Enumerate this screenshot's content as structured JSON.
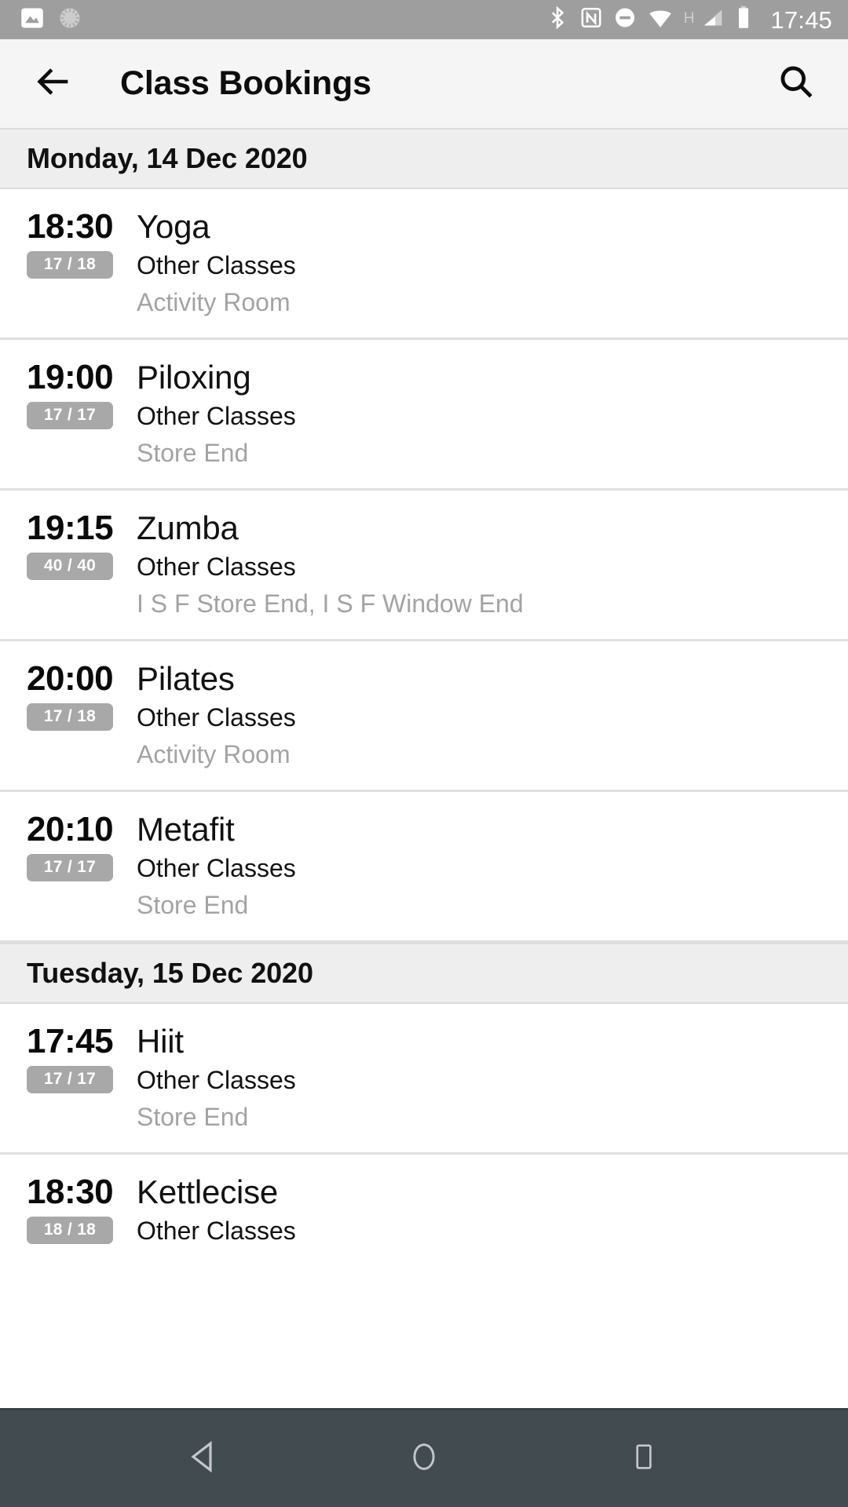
{
  "status_bar": {
    "left_icons": [
      "image-icon",
      "sync-spinner-icon"
    ],
    "right_icons": [
      "bluetooth-icon",
      "nfc-icon",
      "do-not-disturb-icon",
      "wifi-icon",
      "cellular-signal-icon",
      "battery-icon"
    ],
    "network_type": "H",
    "clock": "17:45",
    "background_color": "#9e9e9e"
  },
  "app_bar": {
    "back_icon": "back-arrow-icon",
    "title": "Class Bookings",
    "search_icon": "search-icon",
    "background_color": "#f5f5f5"
  },
  "list": {
    "badge_color": "#a8a8a8",
    "day_header_color": "#eeeeee",
    "sections": [
      {
        "date_label": "Monday, 14 Dec 2020",
        "classes": [
          {
            "time": "18:30",
            "capacity": "17 / 18",
            "title": "Yoga",
            "category": "Other Classes",
            "location": "Activity Room"
          },
          {
            "time": "19:00",
            "capacity": "17 / 17",
            "title": "Piloxing",
            "category": "Other Classes",
            "location": "Store End"
          },
          {
            "time": "19:15",
            "capacity": "40 / 40",
            "title": "Zumba",
            "category": "Other Classes",
            "location": "I S F Store End, I S F Window End"
          },
          {
            "time": "20:00",
            "capacity": "17 / 18",
            "title": "Pilates",
            "category": "Other Classes",
            "location": "Activity Room"
          },
          {
            "time": "20:10",
            "capacity": "17 / 17",
            "title": "Metafit",
            "category": "Other Classes",
            "location": "Store End"
          }
        ]
      },
      {
        "date_label": "Tuesday, 15 Dec 2020",
        "classes": [
          {
            "time": "17:45",
            "capacity": "17 / 17",
            "title": "Hiit",
            "category": "Other Classes",
            "location": "Store End"
          },
          {
            "time": "18:30",
            "capacity": "18 / 18",
            "title": "Kettlecise",
            "category": "Other Classes",
            "location": ""
          }
        ]
      }
    ]
  },
  "nav_bar": {
    "background_color": "#414b50",
    "buttons": [
      {
        "name": "back-nav-button",
        "icon": "triangle-left-icon"
      },
      {
        "name": "home-nav-button",
        "icon": "circle-icon"
      },
      {
        "name": "recents-nav-button",
        "icon": "square-icon"
      }
    ]
  }
}
